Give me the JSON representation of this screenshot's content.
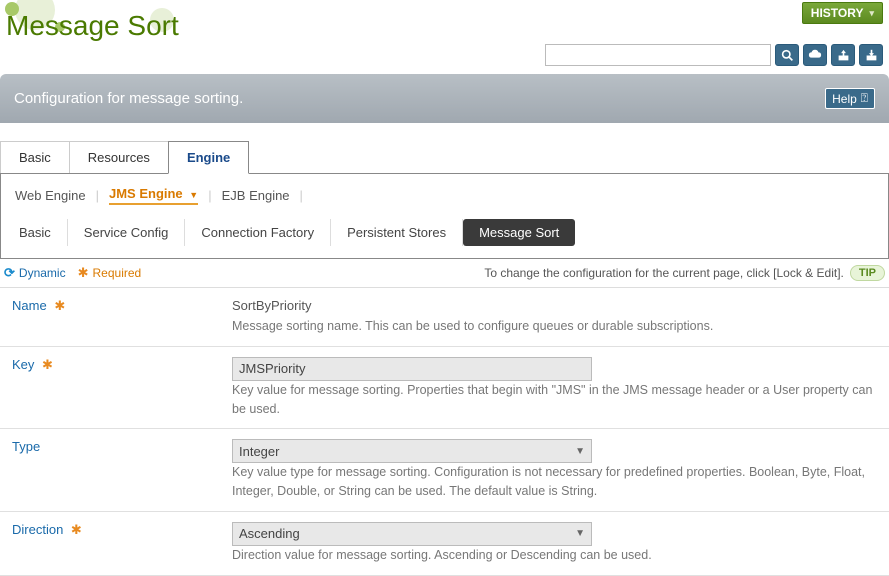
{
  "page_title": "Message Sort",
  "history_label": "HISTORY",
  "search": {
    "placeholder": ""
  },
  "subtitle": "Configuration for message sorting.",
  "help_label": "Help",
  "tabs": {
    "basic": "Basic",
    "resources": "Resources",
    "engine": "Engine"
  },
  "engine_subtabs": {
    "web": "Web Engine",
    "jms": "JMS Engine",
    "ejb": "EJB Engine"
  },
  "jms_subtabs": {
    "basic": "Basic",
    "service_config": "Service Config",
    "connection_factory": "Connection Factory",
    "persistent_stores": "Persistent Stores",
    "message_sort": "Message Sort"
  },
  "legend": {
    "dynamic": "Dynamic",
    "required": "Required",
    "tip_text": "To change the configuration for the current page, click [Lock & Edit].",
    "tip_label": "TIP"
  },
  "fields": {
    "name": {
      "label": "Name",
      "value": "SortByPriority",
      "desc": "Message sorting name. This can be used to configure queues or durable subscriptions."
    },
    "key": {
      "label": "Key",
      "value": "JMSPriority",
      "desc": "Key value for message sorting. Properties that begin with \"JMS\" in the JMS message header or a User property can be used."
    },
    "type": {
      "label": "Type",
      "value": "Integer",
      "desc": "Key value type for message sorting. Configuration is not necessary for predefined properties. Boolean, Byte, Float, Integer, Double, or String can be used. The default value is String."
    },
    "direction": {
      "label": "Direction",
      "value": "Ascending",
      "desc": "Direction value for message sorting. Ascending or Descending can be used."
    }
  }
}
